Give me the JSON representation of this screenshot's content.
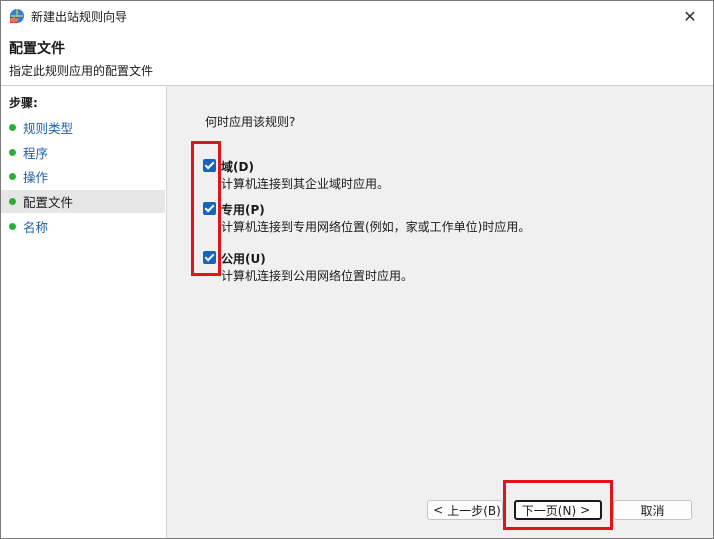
{
  "window": {
    "title": "新建出站规则向导",
    "close_glyph": "✕"
  },
  "header": {
    "title": "配置文件",
    "subtitle": "指定此规则应用的配置文件"
  },
  "sidebar": {
    "steps_label": "步骤:",
    "items": [
      {
        "label": "规则类型",
        "active": false
      },
      {
        "label": "程序",
        "active": false
      },
      {
        "label": "操作",
        "active": false
      },
      {
        "label": "配置文件",
        "active": true
      },
      {
        "label": "名称",
        "active": false
      }
    ]
  },
  "main": {
    "question": "何时应用该规则?",
    "options": [
      {
        "label": "域(D)",
        "description": "计算机连接到其企业域时应用。",
        "checked": true
      },
      {
        "label": "专用(P)",
        "description": "计算机连接到专用网络位置(例如，家或工作单位)时应用。",
        "checked": true
      },
      {
        "label": "公用(U)",
        "description": "计算机连接到公用网络位置时应用。",
        "checked": true
      }
    ]
  },
  "buttons": {
    "back": "上一步(B)",
    "next": "下一页(N)",
    "cancel": "取消",
    "back_chevron": "<",
    "next_chevron": ">"
  },
  "colors": {
    "accent": "#1565c0",
    "step_dot": "#2eac3a",
    "step_link": "#1f5fa8",
    "highlight": "#e0141c"
  }
}
